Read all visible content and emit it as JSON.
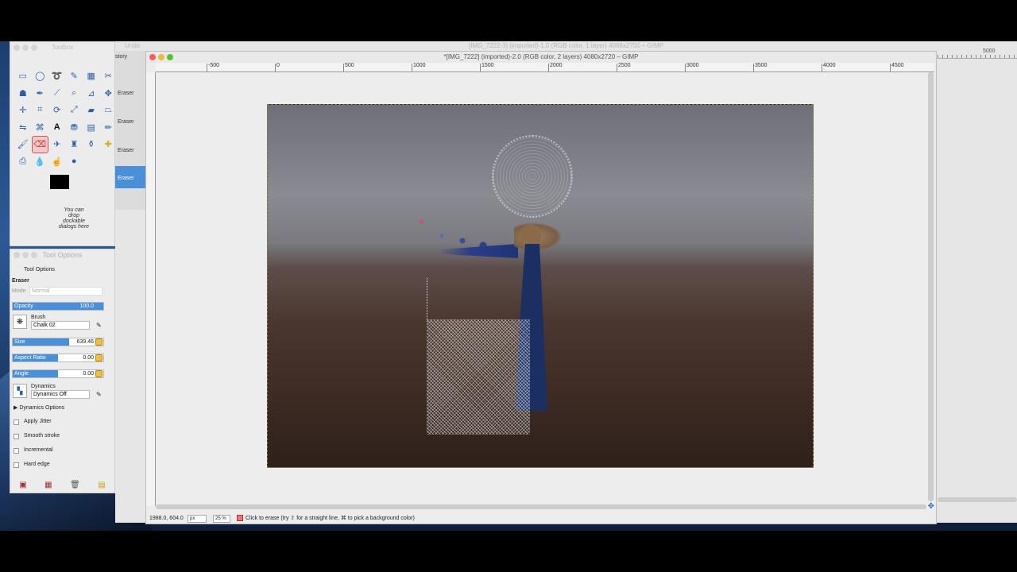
{
  "background_window": {
    "title": "[IMG_7222-3] (imported)-1.0 (RGB color, 1 layer) 4066x2700 – GIMP",
    "undo_label": "Undo",
    "ruler_label": "5000"
  },
  "history_dock": {
    "tab_label": "story",
    "items": [
      "Eraser",
      "Eraser",
      "Eraser",
      "Eraser"
    ]
  },
  "toolbox": {
    "title": "Toolbox",
    "drop_hint": "You can drop dockable dialogs here",
    "fg_color": "#000000",
    "bg_color": "#ffffff"
  },
  "tool_options": {
    "title": "Tool Options",
    "tab_label": "Tool Options",
    "tool_name": "Eraser",
    "mode_label": "Mode",
    "mode_value": "Normal",
    "opacity": {
      "label": "Opacity",
      "value": "100.0",
      "fraction": 1.0
    },
    "brush": {
      "label": "Brush",
      "value": "Chalk 02"
    },
    "size": {
      "label": "Size",
      "value": "639.46",
      "fraction": 0.62
    },
    "aspect_ratio": {
      "label": "Aspect Ratio",
      "value": "0.00",
      "fraction": 0.5
    },
    "angle": {
      "label": "Angle",
      "value": "0.00",
      "fraction": 0.5
    },
    "dynamics": {
      "label": "Dynamics",
      "value": "Dynamics Off"
    },
    "dynamics_options_label": "Dynamics Options",
    "checkboxes": [
      "Apply Jitter",
      "Smooth stroke",
      "Incremental",
      "Hard edge"
    ]
  },
  "main_window": {
    "title": "*[IMG_7222] (imported)-2.0 (RGB color, 2 layers) 4080x2720 – GIMP",
    "ruler_labels": [
      "-500",
      "0",
      "500",
      "1000",
      "1500",
      "2000",
      "2500",
      "3000",
      "3500",
      "4000",
      "4500"
    ],
    "status": {
      "coordinates": "1988.0, 604.0",
      "unit": "px",
      "zoom": "25 %",
      "message": "Click to erase (try ⇧ for a straight line, ⌘ to pick a background color)"
    }
  },
  "accent_color": "#4a90d9"
}
